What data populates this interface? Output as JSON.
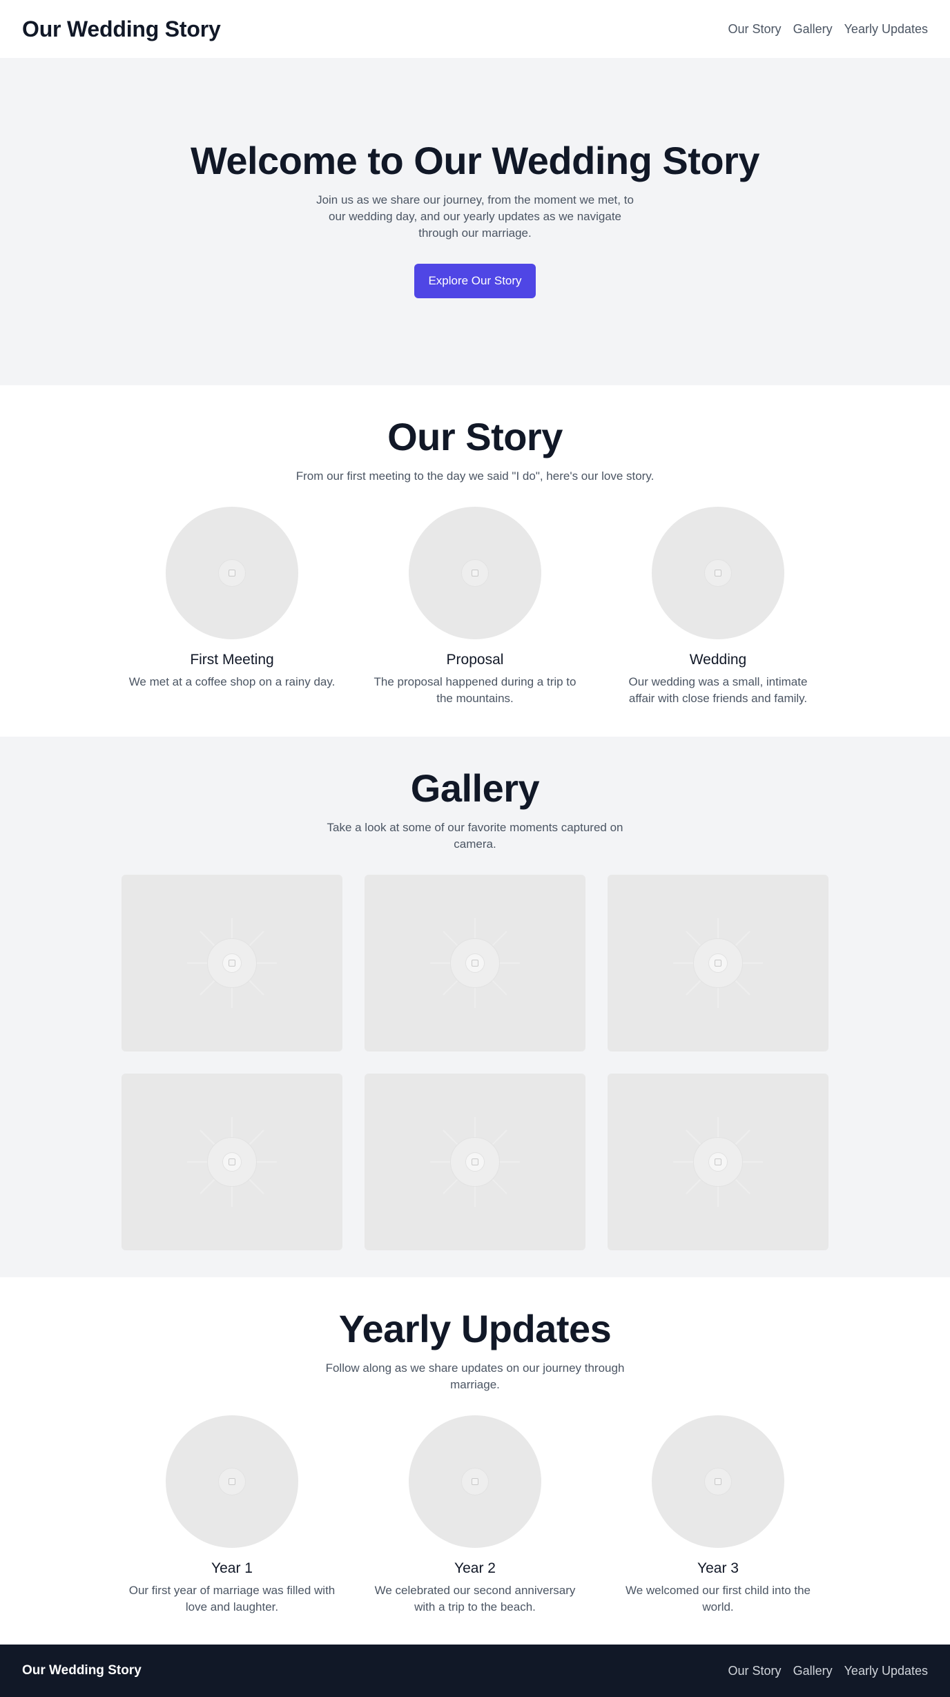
{
  "header": {
    "brand": "Our Wedding Story",
    "nav": [
      "Our Story",
      "Gallery",
      "Yearly Updates"
    ]
  },
  "hero": {
    "title": "Welcome to Our Wedding Story",
    "subtitle": "Join us as we share our journey, from the moment we met, to our wedding day, and our yearly updates as we navigate through our marriage.",
    "cta_label": "Explore Our Story",
    "cta_color": "#4f46e5"
  },
  "story": {
    "title": "Our Story",
    "lead": "From our first meeting to the day we said \"I do\", here's our love story.",
    "cards": [
      {
        "title": "First Meeting",
        "text": "We met at a coffee shop on a rainy day.",
        "icon": "image-placeholder-icon"
      },
      {
        "title": "Proposal",
        "text": "The proposal happened during a trip to the mountains.",
        "icon": "image-placeholder-icon"
      },
      {
        "title": "Wedding",
        "text": "Our wedding was a small, intimate affair with close friends and family.",
        "icon": "image-placeholder-icon"
      }
    ]
  },
  "gallery": {
    "title": "Gallery",
    "lead": "Take a look at some of our favorite moments captured on camera.",
    "photo_count": 6
  },
  "updates": {
    "title": "Yearly Updates",
    "lead": "Follow along as we share updates on our journey through marriage.",
    "cards": [
      {
        "title": "Year 1",
        "text": "Our first year of marriage was filled with love and laughter."
      },
      {
        "title": "Year 2",
        "text": "We celebrated our second anniversary with a trip to the beach."
      },
      {
        "title": "Year 3",
        "text": "We welcomed our first child into the world."
      }
    ]
  },
  "footer": {
    "brand": "Our Wedding Story",
    "nav": [
      "Our Story",
      "Gallery",
      "Yearly Updates"
    ],
    "background": "#111827"
  }
}
